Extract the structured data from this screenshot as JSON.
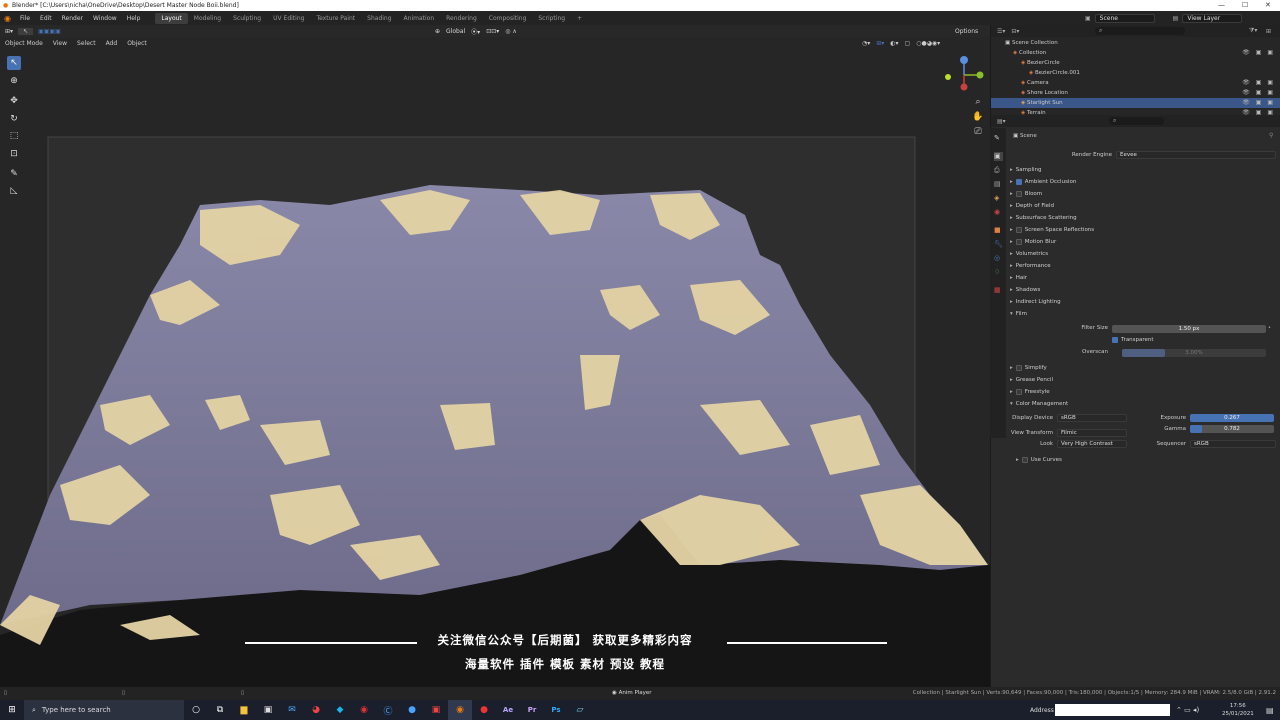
{
  "window": {
    "title": "Blender* [C:\\Users\\nicha\\OneDrive\\Desktop\\Desert Master Node Boii.blend]"
  },
  "menu": [
    "File",
    "Edit",
    "Render",
    "Window",
    "Help"
  ],
  "workspaces": [
    "Layout",
    "Modeling",
    "Sculpting",
    "UV Editing",
    "Texture Paint",
    "Shading",
    "Animation",
    "Rendering",
    "Compositing",
    "Scripting"
  ],
  "active_workspace": "Layout",
  "top_right": {
    "scene": "Scene",
    "view_layer": "View Layer"
  },
  "viewport_header": {
    "mode": "Object Mode",
    "menus": [
      "View",
      "Select",
      "Add",
      "Object"
    ],
    "orientation": "Global",
    "options": "Options"
  },
  "subtitle": {
    "line1": "关注微信公众号【后期菌】 获取更多精彩内容",
    "line2": "海量软件 插件 模板 素材 预设 教程"
  },
  "outliner": {
    "root": "Scene Collection",
    "items": [
      {
        "label": "Collection",
        "depth": 1,
        "selected": false
      },
      {
        "label": "BezierCircle",
        "depth": 2,
        "selected": false
      },
      {
        "label": "BezierCircle.001",
        "depth": 3,
        "selected": false
      },
      {
        "label": "Camera",
        "depth": 2,
        "selected": false
      },
      {
        "label": "Shore Location",
        "depth": 2,
        "selected": false
      },
      {
        "label": "Starlight Sun",
        "depth": 2,
        "selected": true
      },
      {
        "label": "Terrain",
        "depth": 2,
        "selected": false
      }
    ]
  },
  "properties": {
    "context": "Scene",
    "render_engine_label": "Render Engine",
    "render_engine": "Eevee",
    "panels": [
      {
        "label": "Sampling",
        "checkbox": null,
        "open": false
      },
      {
        "label": "Ambient Occlusion",
        "checkbox": true,
        "open": false
      },
      {
        "label": "Bloom",
        "checkbox": false,
        "open": false
      },
      {
        "label": "Depth of Field",
        "checkbox": null,
        "open": false
      },
      {
        "label": "Subsurface Scattering",
        "checkbox": null,
        "open": false
      },
      {
        "label": "Screen Space Reflections",
        "checkbox": false,
        "open": false
      },
      {
        "label": "Motion Blur",
        "checkbox": false,
        "open": false
      },
      {
        "label": "Volumetrics",
        "checkbox": null,
        "open": false
      },
      {
        "label": "Performance",
        "checkbox": null,
        "open": false
      },
      {
        "label": "Hair",
        "checkbox": null,
        "open": false
      },
      {
        "label": "Shadows",
        "checkbox": null,
        "open": false
      },
      {
        "label": "Indirect Lighting",
        "checkbox": null,
        "open": false
      },
      {
        "label": "Film",
        "checkbox": null,
        "open": true
      }
    ],
    "film": {
      "filter_size_label": "Filter Size",
      "filter_size": "1.50 px",
      "transparent_label": "Transparent",
      "transparent": true,
      "overscan_label": "Overscan",
      "overscan": "3.00%"
    },
    "panels2": [
      {
        "label": "Simplify",
        "checkbox": false
      },
      {
        "label": "Grease Pencil",
        "checkbox": null
      },
      {
        "label": "Freestyle",
        "checkbox": false
      },
      {
        "label": "Color Management",
        "checkbox": null,
        "open": true
      }
    ],
    "color_management": {
      "display_device_label": "Display Device",
      "display_device": "sRGB",
      "view_transform_label": "View Transform",
      "view_transform": "Filmic",
      "look_label": "Look",
      "look": "Very High Contrast",
      "exposure_label": "Exposure",
      "exposure": "0.267",
      "gamma_label": "Gamma",
      "gamma": "0.782",
      "sequencer_label": "Sequencer",
      "sequencer": "sRGB",
      "use_curves_label": "Use Curves"
    }
  },
  "statusbar": {
    "center": "Anim Player",
    "right": "Collection | Starlight Sun | Verts:90,649 | Faces:90,000 | Tris:180,000 | Objects:1/5 | Memory: 284.9 MiB | VRAM: 2.5/8.0 GiB | 2.91.2"
  },
  "taskbar": {
    "search_placeholder": "Type here to search",
    "address_label": "Address",
    "time": "17:56",
    "date": "25/01/2021"
  },
  "colors": {
    "accent": "#4772b3",
    "selection": "#3b5689",
    "sand": "#e6d5a8",
    "rock": "#7d7a98"
  }
}
